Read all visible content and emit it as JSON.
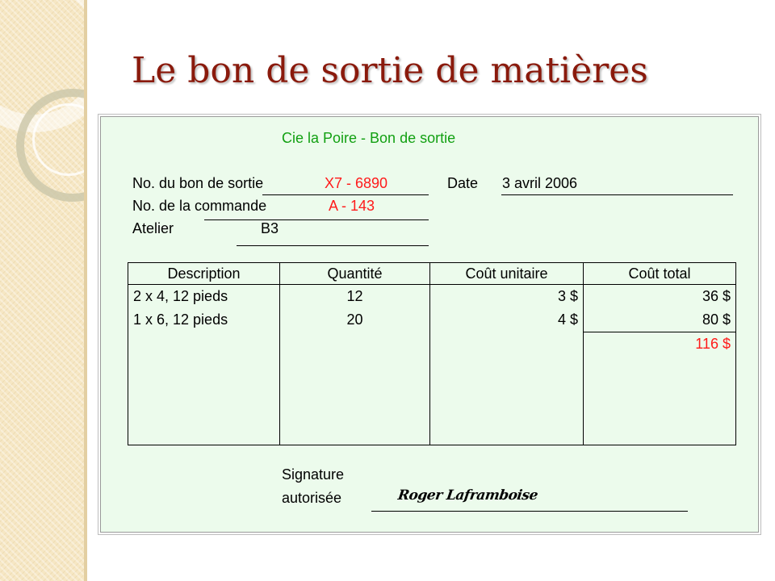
{
  "slide": {
    "title": "Le bon de sortie de matières"
  },
  "form": {
    "heading": "Cie la Poire - Bon de sortie",
    "bon_label": "No. du bon de sortie",
    "bon_value": "X7 - 6890",
    "date_label": "Date",
    "date_value": "3 avril 2006",
    "commande_label": "No. de la commande",
    "commande_value": "A - 143",
    "atelier_label": "Atelier",
    "atelier_value": "B3",
    "table": {
      "headers": [
        "Description",
        "Quantité",
        "Coût unitaire",
        "Coût total"
      ],
      "rows": [
        {
          "description": "2 x 4, 12 pieds",
          "quantite": "12",
          "cout_unitaire": "3 $",
          "cout_total": "36 $"
        },
        {
          "description": "1 x 6, 12 pieds",
          "quantite": "20",
          "cout_unitaire": "4 $",
          "cout_total": "80 $"
        }
      ],
      "total": "116 $"
    },
    "signature_label_1": "Signature",
    "signature_label_2": "autorisée",
    "signature_name": "Roger Laframboise"
  },
  "colors": {
    "title": "#8a1a0c",
    "heading": "#12a012",
    "highlight": "#ff1a1a",
    "form_background": "#ecfbec",
    "strip": "#f6e7c4"
  }
}
